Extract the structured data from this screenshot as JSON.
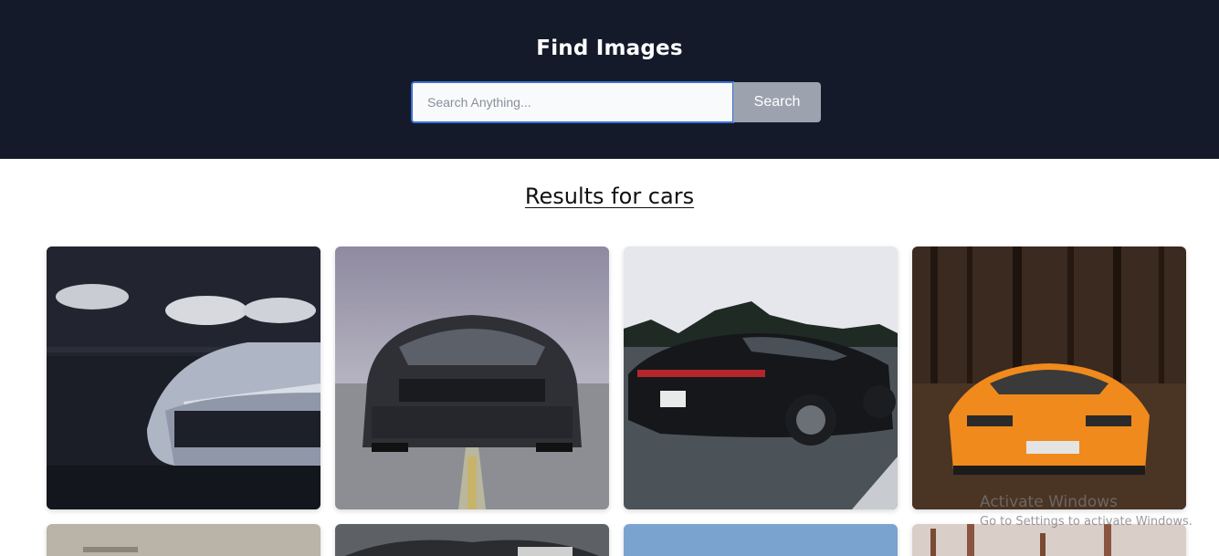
{
  "header": {
    "title": "Find Images",
    "search": {
      "placeholder": "Search Anything...",
      "value": "",
      "button_label": "Search"
    }
  },
  "results": {
    "heading": "Results for cars"
  },
  "images": [
    {
      "subject": "white sports car in dark garage"
    },
    {
      "subject": "black muscle car front view on road"
    },
    {
      "subject": "black sedan driving on road"
    },
    {
      "subject": "orange supercar in forest"
    },
    {
      "subject": "car image row 2 column 1"
    },
    {
      "subject": "car image row 2 column 2"
    },
    {
      "subject": "car image row 2 column 3"
    },
    {
      "subject": "car image row 2 column 4"
    }
  ],
  "os_watermark": {
    "title": "Activate Windows",
    "subtitle": "Go to Settings to activate Windows."
  },
  "colors": {
    "header_bg": "#141a2a",
    "search_border": "#3b6fd6",
    "button_bg": "#9ca3af"
  }
}
